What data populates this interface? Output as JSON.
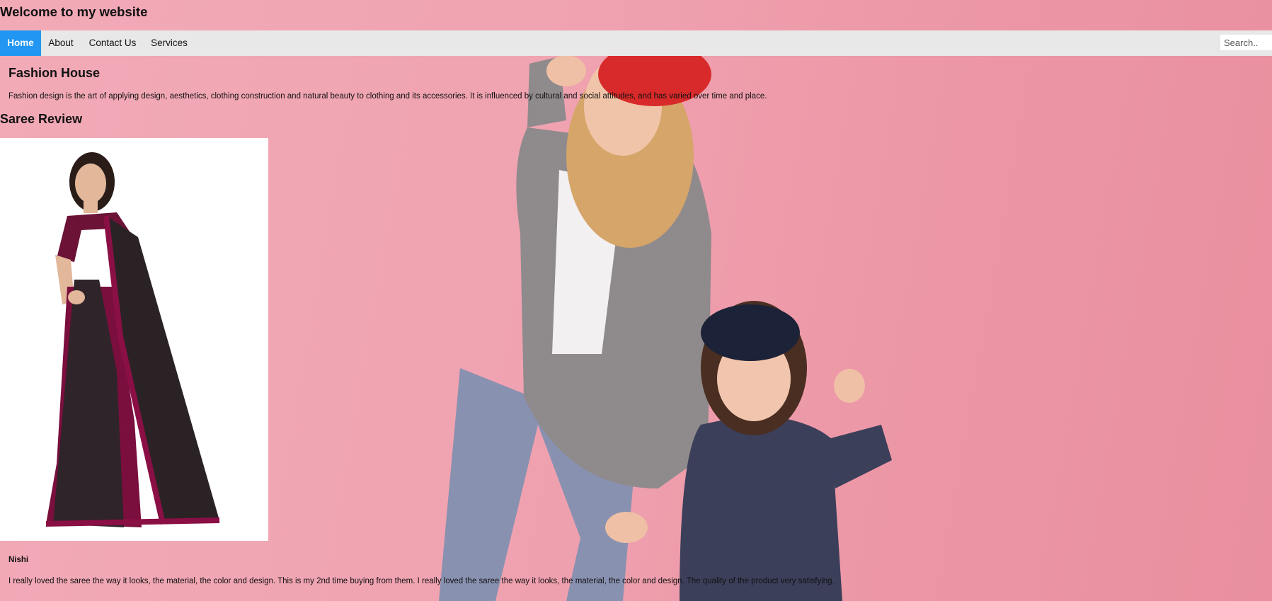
{
  "header": {
    "site_title": "Welcome to my website"
  },
  "nav": {
    "items": [
      {
        "label": "Home",
        "active": true
      },
      {
        "label": "About",
        "active": false
      },
      {
        "label": "Contact Us",
        "active": false
      },
      {
        "label": "Services",
        "active": false
      }
    ],
    "search_placeholder": "Search.."
  },
  "intro": {
    "title": "Fashion House",
    "text": "Fashion design is the art of applying design, aesthetics, clothing construction and natural beauty to clothing and its accessories. It is influenced by cultural and social attitudes, and has varied over time and place."
  },
  "review": {
    "section_title": "Saree Review",
    "reviewer": "Nishi",
    "text": "I really loved the saree the way it looks, the material, the color and design. This is my 2nd time buying from them. I really loved the saree the way it looks, the material, the color and design. The quality of the product very satisfying."
  },
  "colors": {
    "nav_active": "#2196F3",
    "nav_bg": "#e8e8e8",
    "page_bg": "#f0a3b1"
  }
}
